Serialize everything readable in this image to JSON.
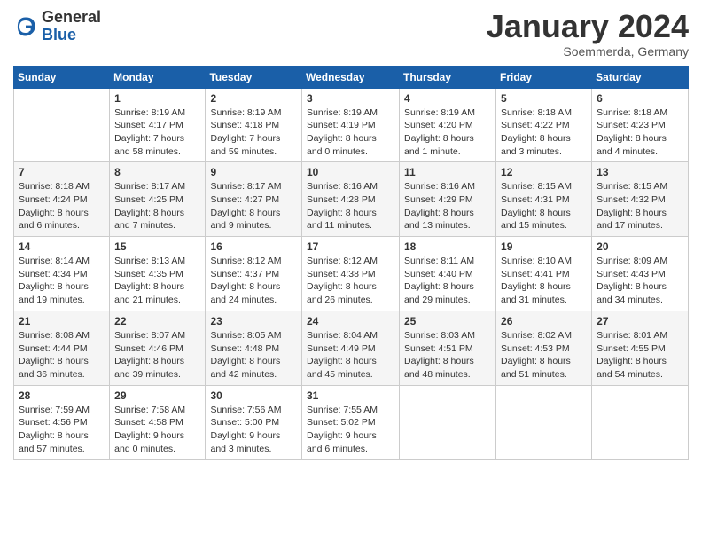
{
  "logo": {
    "general": "General",
    "blue": "Blue"
  },
  "header": {
    "month": "January 2024",
    "location": "Soemmerda, Germany"
  },
  "days_of_week": [
    "Sunday",
    "Monday",
    "Tuesday",
    "Wednesday",
    "Thursday",
    "Friday",
    "Saturday"
  ],
  "weeks": [
    [
      {
        "day": "",
        "sunrise": "",
        "sunset": "",
        "daylight": ""
      },
      {
        "day": "1",
        "sunrise": "Sunrise: 8:19 AM",
        "sunset": "Sunset: 4:17 PM",
        "daylight": "Daylight: 7 hours and 58 minutes."
      },
      {
        "day": "2",
        "sunrise": "Sunrise: 8:19 AM",
        "sunset": "Sunset: 4:18 PM",
        "daylight": "Daylight: 7 hours and 59 minutes."
      },
      {
        "day": "3",
        "sunrise": "Sunrise: 8:19 AM",
        "sunset": "Sunset: 4:19 PM",
        "daylight": "Daylight: 8 hours and 0 minutes."
      },
      {
        "day": "4",
        "sunrise": "Sunrise: 8:19 AM",
        "sunset": "Sunset: 4:20 PM",
        "daylight": "Daylight: 8 hours and 1 minute."
      },
      {
        "day": "5",
        "sunrise": "Sunrise: 8:18 AM",
        "sunset": "Sunset: 4:22 PM",
        "daylight": "Daylight: 8 hours and 3 minutes."
      },
      {
        "day": "6",
        "sunrise": "Sunrise: 8:18 AM",
        "sunset": "Sunset: 4:23 PM",
        "daylight": "Daylight: 8 hours and 4 minutes."
      }
    ],
    [
      {
        "day": "7",
        "sunrise": "Sunrise: 8:18 AM",
        "sunset": "Sunset: 4:24 PM",
        "daylight": "Daylight: 8 hours and 6 minutes."
      },
      {
        "day": "8",
        "sunrise": "Sunrise: 8:17 AM",
        "sunset": "Sunset: 4:25 PM",
        "daylight": "Daylight: 8 hours and 7 minutes."
      },
      {
        "day": "9",
        "sunrise": "Sunrise: 8:17 AM",
        "sunset": "Sunset: 4:27 PM",
        "daylight": "Daylight: 8 hours and 9 minutes."
      },
      {
        "day": "10",
        "sunrise": "Sunrise: 8:16 AM",
        "sunset": "Sunset: 4:28 PM",
        "daylight": "Daylight: 8 hours and 11 minutes."
      },
      {
        "day": "11",
        "sunrise": "Sunrise: 8:16 AM",
        "sunset": "Sunset: 4:29 PM",
        "daylight": "Daylight: 8 hours and 13 minutes."
      },
      {
        "day": "12",
        "sunrise": "Sunrise: 8:15 AM",
        "sunset": "Sunset: 4:31 PM",
        "daylight": "Daylight: 8 hours and 15 minutes."
      },
      {
        "day": "13",
        "sunrise": "Sunrise: 8:15 AM",
        "sunset": "Sunset: 4:32 PM",
        "daylight": "Daylight: 8 hours and 17 minutes."
      }
    ],
    [
      {
        "day": "14",
        "sunrise": "Sunrise: 8:14 AM",
        "sunset": "Sunset: 4:34 PM",
        "daylight": "Daylight: 8 hours and 19 minutes."
      },
      {
        "day": "15",
        "sunrise": "Sunrise: 8:13 AM",
        "sunset": "Sunset: 4:35 PM",
        "daylight": "Daylight: 8 hours and 21 minutes."
      },
      {
        "day": "16",
        "sunrise": "Sunrise: 8:12 AM",
        "sunset": "Sunset: 4:37 PM",
        "daylight": "Daylight: 8 hours and 24 minutes."
      },
      {
        "day": "17",
        "sunrise": "Sunrise: 8:12 AM",
        "sunset": "Sunset: 4:38 PM",
        "daylight": "Daylight: 8 hours and 26 minutes."
      },
      {
        "day": "18",
        "sunrise": "Sunrise: 8:11 AM",
        "sunset": "Sunset: 4:40 PM",
        "daylight": "Daylight: 8 hours and 29 minutes."
      },
      {
        "day": "19",
        "sunrise": "Sunrise: 8:10 AM",
        "sunset": "Sunset: 4:41 PM",
        "daylight": "Daylight: 8 hours and 31 minutes."
      },
      {
        "day": "20",
        "sunrise": "Sunrise: 8:09 AM",
        "sunset": "Sunset: 4:43 PM",
        "daylight": "Daylight: 8 hours and 34 minutes."
      }
    ],
    [
      {
        "day": "21",
        "sunrise": "Sunrise: 8:08 AM",
        "sunset": "Sunset: 4:44 PM",
        "daylight": "Daylight: 8 hours and 36 minutes."
      },
      {
        "day": "22",
        "sunrise": "Sunrise: 8:07 AM",
        "sunset": "Sunset: 4:46 PM",
        "daylight": "Daylight: 8 hours and 39 minutes."
      },
      {
        "day": "23",
        "sunrise": "Sunrise: 8:05 AM",
        "sunset": "Sunset: 4:48 PM",
        "daylight": "Daylight: 8 hours and 42 minutes."
      },
      {
        "day": "24",
        "sunrise": "Sunrise: 8:04 AM",
        "sunset": "Sunset: 4:49 PM",
        "daylight": "Daylight: 8 hours and 45 minutes."
      },
      {
        "day": "25",
        "sunrise": "Sunrise: 8:03 AM",
        "sunset": "Sunset: 4:51 PM",
        "daylight": "Daylight: 8 hours and 48 minutes."
      },
      {
        "day": "26",
        "sunrise": "Sunrise: 8:02 AM",
        "sunset": "Sunset: 4:53 PM",
        "daylight": "Daylight: 8 hours and 51 minutes."
      },
      {
        "day": "27",
        "sunrise": "Sunrise: 8:01 AM",
        "sunset": "Sunset: 4:55 PM",
        "daylight": "Daylight: 8 hours and 54 minutes."
      }
    ],
    [
      {
        "day": "28",
        "sunrise": "Sunrise: 7:59 AM",
        "sunset": "Sunset: 4:56 PM",
        "daylight": "Daylight: 8 hours and 57 minutes."
      },
      {
        "day": "29",
        "sunrise": "Sunrise: 7:58 AM",
        "sunset": "Sunset: 4:58 PM",
        "daylight": "Daylight: 9 hours and 0 minutes."
      },
      {
        "day": "30",
        "sunrise": "Sunrise: 7:56 AM",
        "sunset": "Sunset: 5:00 PM",
        "daylight": "Daylight: 9 hours and 3 minutes."
      },
      {
        "day": "31",
        "sunrise": "Sunrise: 7:55 AM",
        "sunset": "Sunset: 5:02 PM",
        "daylight": "Daylight: 9 hours and 6 minutes."
      },
      {
        "day": "",
        "sunrise": "",
        "sunset": "",
        "daylight": ""
      },
      {
        "day": "",
        "sunrise": "",
        "sunset": "",
        "daylight": ""
      },
      {
        "day": "",
        "sunrise": "",
        "sunset": "",
        "daylight": ""
      }
    ]
  ]
}
